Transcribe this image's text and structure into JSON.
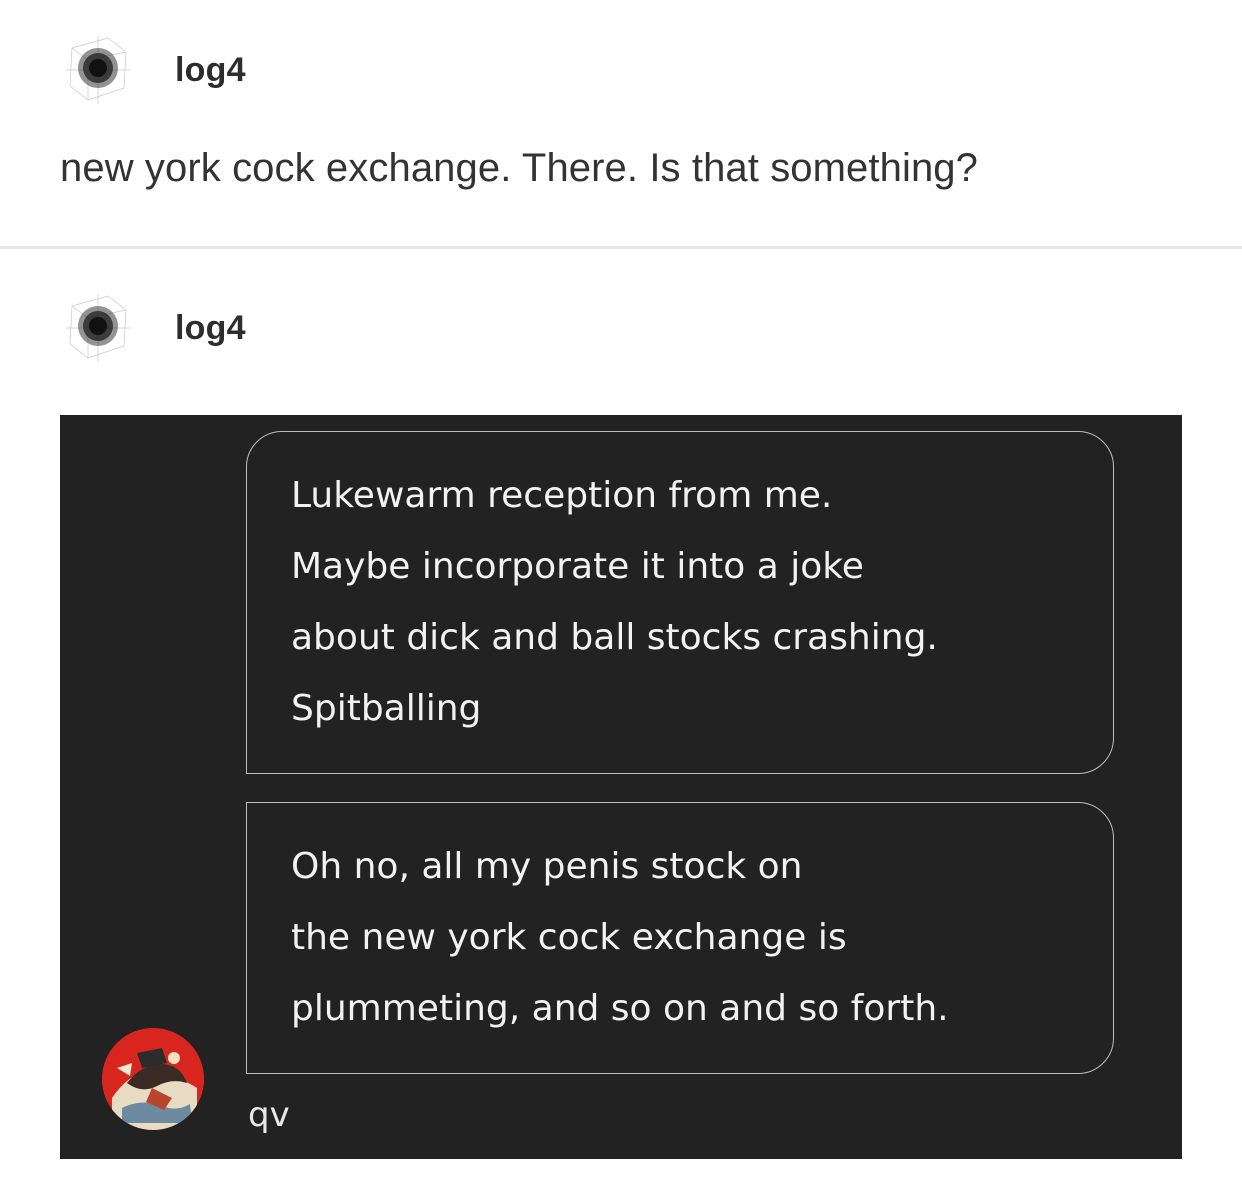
{
  "post1": {
    "username": "log4",
    "text": "new york cock exchange. There. Is that something?"
  },
  "post2": {
    "username": "log4",
    "messages": [
      {
        "lines": [
          "Lukewarm reception from me.",
          "Maybe incorporate it into a joke",
          "about dick and ball stocks crashing.",
          "Spitballing"
        ]
      },
      {
        "lines": [
          "Oh no, all my penis stock on",
          "the new york cock exchange is",
          "plummeting, and so on and so forth."
        ]
      }
    ],
    "sender_name": "qv"
  }
}
